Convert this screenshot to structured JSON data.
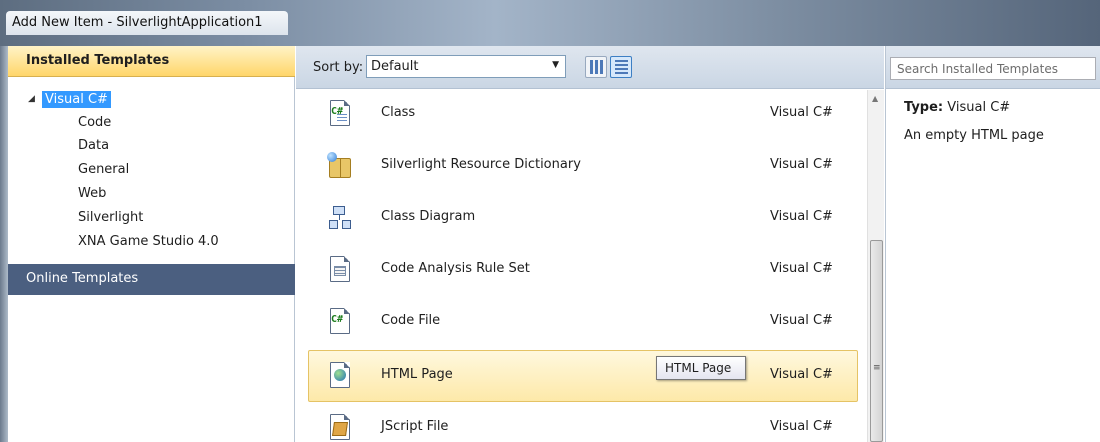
{
  "window": {
    "title": "Add New Item - SilverlightApplication1"
  },
  "left_panel": {
    "installed_header": "Installed Templates",
    "tree_root": "Visual C#",
    "tree_children": [
      "Code",
      "Data",
      "General",
      "Web",
      "Silverlight",
      "XNA Game Studio 4.0"
    ],
    "online_templates": "Online Templates"
  },
  "toolbar": {
    "sort_label": "Sort by:",
    "sort_value": "Default"
  },
  "items": [
    {
      "name": "Class",
      "type": "Visual C#",
      "icon": "csharp-class-icon"
    },
    {
      "name": "Silverlight Resource Dictionary",
      "type": "Visual C#",
      "icon": "resource-dictionary-icon"
    },
    {
      "name": "Class Diagram",
      "type": "Visual C#",
      "icon": "class-diagram-icon"
    },
    {
      "name": "Code Analysis Rule Set",
      "type": "Visual C#",
      "icon": "rule-set-icon"
    },
    {
      "name": "Code File",
      "type": "Visual C#",
      "icon": "csharp-code-file-icon"
    },
    {
      "name": "HTML Page",
      "type": "Visual C#",
      "icon": "html-page-icon"
    },
    {
      "name": "JScript File",
      "type": "Visual C#",
      "icon": "jscript-file-icon"
    }
  ],
  "selected_item": "HTML Page",
  "tooltip": "HTML Page",
  "search": {
    "placeholder": "Search Installed Templates",
    "value": ""
  },
  "details": {
    "type_label": "Type:",
    "type_value": "Visual C#",
    "description": "An empty HTML page"
  }
}
